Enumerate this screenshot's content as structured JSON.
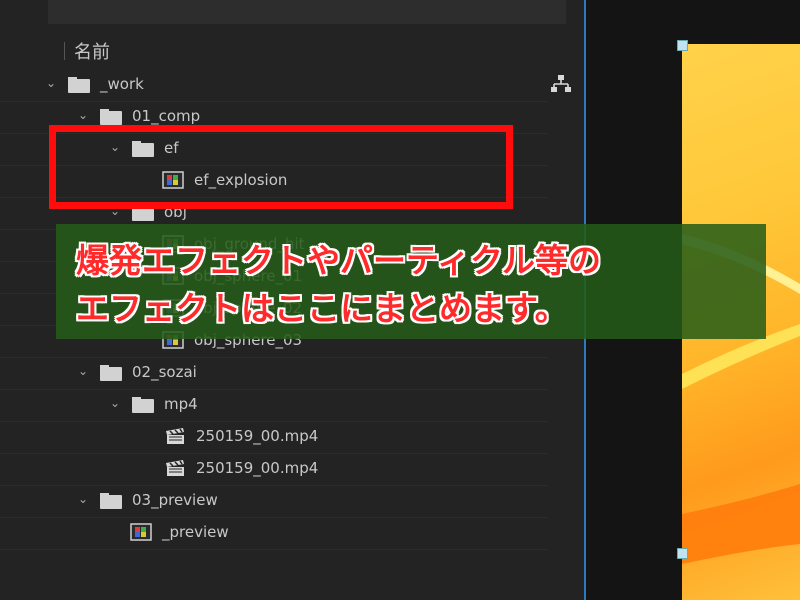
{
  "project_panel": {
    "column_header": "名前",
    "rows": [
      {
        "label": "_work",
        "kind": "folder"
      },
      {
        "label": "01_comp",
        "kind": "folder"
      },
      {
        "label": "ef",
        "kind": "folder"
      },
      {
        "label": "ef_explosion",
        "kind": "comp"
      },
      {
        "label": "obj",
        "kind": "folder"
      },
      {
        "label": "obj_ground_hit",
        "kind": "comp"
      },
      {
        "label": "obj_sphere_01",
        "kind": "comp"
      },
      {
        "label": "obj_sphere_02",
        "kind": "comp"
      },
      {
        "label": "obj_sphere_03",
        "kind": "comp"
      },
      {
        "label": "02_sozai",
        "kind": "folder"
      },
      {
        "label": "mp4",
        "kind": "folder"
      },
      {
        "label": "250159_00.mp4",
        "kind": "footage"
      },
      {
        "label": "250159_00.mp4",
        "kind": "footage"
      },
      {
        "label": "03_preview",
        "kind": "folder"
      },
      {
        "label": "_preview",
        "kind": "comp"
      }
    ]
  },
  "annotation": {
    "line1": "爆発エフェクトやパーティクル等の",
    "line2": "エフェクトはここにまとめます。",
    "highlight_color": "#ff0d0d",
    "text_color": "#ff2a2a"
  },
  "icons": {
    "folder": "folder-icon",
    "comp": "composition-icon",
    "footage": "footage-clapper-icon",
    "flowchart": "flowchart-icon"
  }
}
